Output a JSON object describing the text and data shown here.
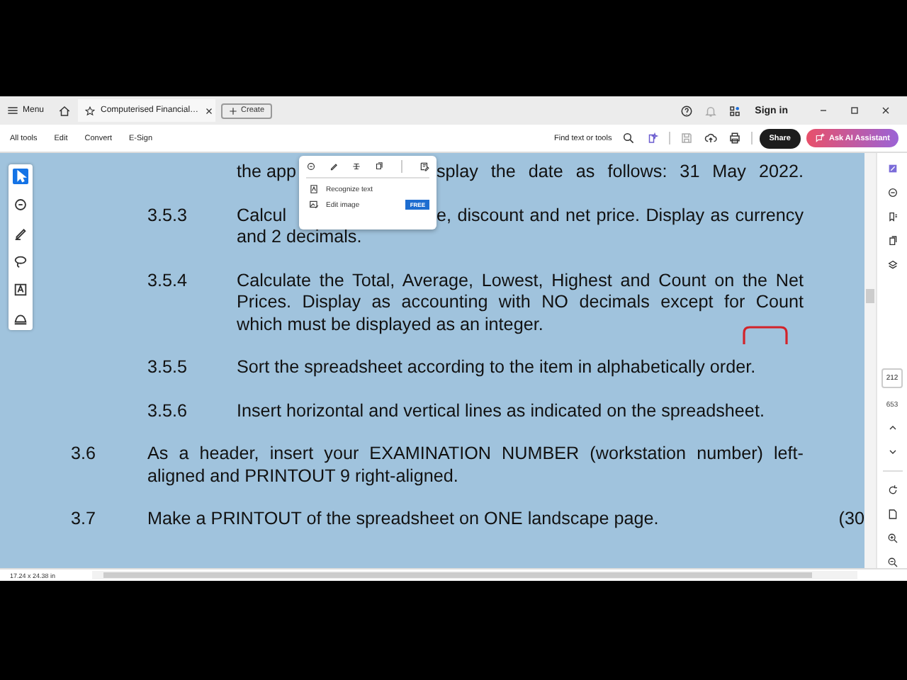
{
  "title_bar": {
    "menu": "Menu",
    "tabs": [
      {
        "label": "Computerised Financial…",
        "selected": true
      }
    ],
    "create": "Create",
    "sign_in": "Sign in"
  },
  "toolbar": {
    "menus": [
      "All tools",
      "Edit",
      "Convert",
      "E-Sign"
    ],
    "search": "Find text or tools",
    "share": "Share",
    "assistant": "Ask AI Assistant"
  },
  "left_tools": [
    {
      "kind": "select",
      "selected": true
    },
    {
      "kind": "comment",
      "selected": false
    },
    {
      "kind": "pen",
      "selected": false
    },
    {
      "kind": "lasso",
      "selected": false
    },
    {
      "kind": "text",
      "selected": false
    },
    {
      "kind": "stamp",
      "selected": false
    }
  ],
  "popup": {
    "items": [
      {
        "label": "Recognize text"
      },
      {
        "label": "Edit image",
        "badge": "FREE"
      }
    ]
  },
  "document": {
    "items": [
      {
        "kind": "sub",
        "lines": [
          {
            "before": "the app",
            "after": "splay the date as follows: 31 May 2022."
          }
        ]
      },
      {
        "kind": "sub",
        "number": "3.5.3",
        "lines": [
          {
            "before": "Calcul",
            "after": "e, discount and net price. Display as currency"
          },
          {
            "text": "and 2 decimals."
          }
        ]
      },
      {
        "kind": "sub",
        "number": "3.5.4",
        "lines": [
          {
            "text": "Calculate the Total, Average, Lowest, Highest and Count on the Net"
          },
          {
            "text": "Prices. Display as accounting with NO decimals except for Count"
          },
          {
            "text": "which must be displayed as an integer."
          }
        ]
      },
      {
        "kind": "sub",
        "number": "3.5.5",
        "lines": [
          {
            "text": "Sort the spreadsheet according to the item in alphabetically order."
          }
        ]
      },
      {
        "kind": "sub",
        "number": "3.5.6",
        "lines": [
          {
            "text": "Insert horizontal and vertical lines as indicated on the spreadsheet."
          }
        ]
      },
      {
        "kind": "section",
        "number": "3.6",
        "lines": [
          {
            "text": "As a header, insert your EXAMINATION NUMBER (workstation number) left-"
          },
          {
            "text": "aligned and PRINTOUT 9 right-aligned."
          }
        ]
      },
      {
        "kind": "section",
        "number": "3.7",
        "lines": [
          {
            "text": "Make a PRINTOUT of the spreadsheet on ONE landscape page."
          }
        ],
        "marks": "(30"
      }
    ]
  },
  "page_nav": {
    "current": "212",
    "total": "653"
  },
  "status_bar": {
    "size": "17.24 x 24.38 in"
  }
}
